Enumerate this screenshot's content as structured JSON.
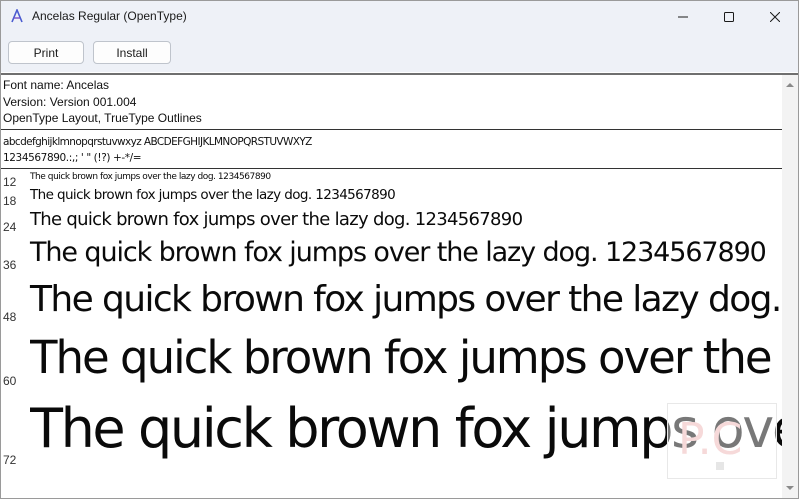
{
  "window": {
    "title": "Ancelas Regular (OpenType)",
    "icon": "font-viewer-icon"
  },
  "toolbar": {
    "print_label": "Print",
    "install_label": "Install"
  },
  "font_info": {
    "name_line": "Font name: Ancelas",
    "version_line": "Version: Version 001.004",
    "type_line": "OpenType Layout, TrueType Outlines"
  },
  "charset": {
    "line1": "abcdefghijklmnopqrstuvwxyz ABCDEFGHIJKLMNOPQRSTUVWXYZ",
    "line2": "1234567890.:,; ' \" (!?) +-*/="
  },
  "samples": [
    {
      "size": "12",
      "text": "The quick brown fox jumps over the lazy dog. 1234567890"
    },
    {
      "size": "18",
      "text": "The quick brown fox jumps over the lazy dog. 1234567890"
    },
    {
      "size": "24",
      "text": "The quick brown fox jumps over the lazy dog. 1234567890"
    },
    {
      "size": "36",
      "text": "The quick brown fox jumps over the lazy dog. 1234567890"
    },
    {
      "size": "48",
      "text": "The quick brown fox jumps over the lazy dog."
    },
    {
      "size": "60",
      "text": "The quick brown fox jumps over the l"
    },
    {
      "size": "72",
      "text": "The quick brown fox jumps ove"
    }
  ],
  "colors": {
    "titlebar": "#eef1f7",
    "text": "#111111"
  }
}
